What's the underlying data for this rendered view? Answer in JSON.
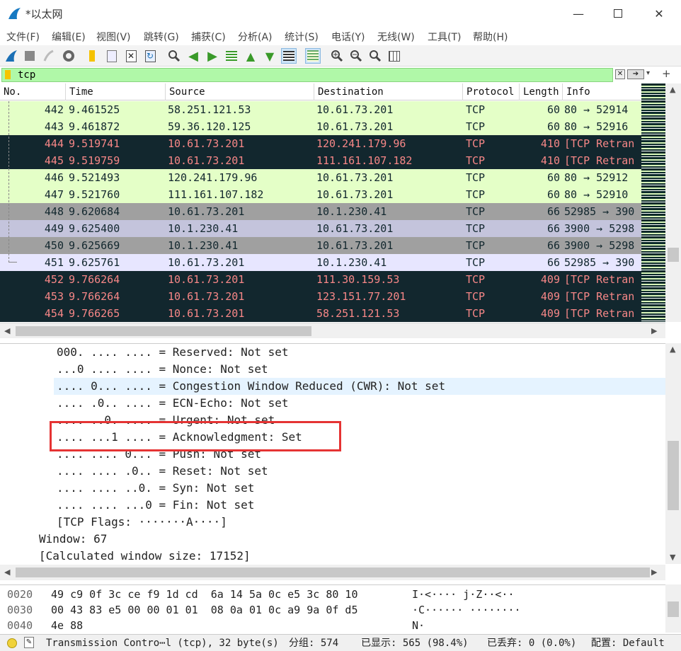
{
  "window": {
    "title": "*以太网"
  },
  "menu": [
    "文件(F)",
    "编辑(E)",
    "视图(V)",
    "跳转(G)",
    "捕获(C)",
    "分析(A)",
    "统计(S)",
    "电话(Y)",
    "无线(W)",
    "工具(T)",
    "帮助(H)"
  ],
  "filter": {
    "value": "tcp"
  },
  "columns": [
    "No.",
    "Time",
    "Source",
    "Destination",
    "Protocol",
    "Length",
    "Info"
  ],
  "packets": [
    {
      "no": "442",
      "time": "9.461525",
      "src": "58.251.121.53",
      "dst": "10.61.73.201",
      "proto": "TCP",
      "len": "60",
      "info": "80 → 52914",
      "bg": "#e4ffc7",
      "fg": "#12272e"
    },
    {
      "no": "443",
      "time": "9.461872",
      "src": "59.36.120.125",
      "dst": "10.61.73.201",
      "proto": "TCP",
      "len": "60",
      "info": "80 → 52916",
      "bg": "#e4ffc7",
      "fg": "#12272e"
    },
    {
      "no": "444",
      "time": "9.519741",
      "src": "10.61.73.201",
      "dst": "120.241.179.96",
      "proto": "TCP",
      "len": "410",
      "info": "[TCP Retran",
      "bg": "#12272e",
      "fg": "#f78787"
    },
    {
      "no": "445",
      "time": "9.519759",
      "src": "10.61.73.201",
      "dst": "111.161.107.182",
      "proto": "TCP",
      "len": "410",
      "info": "[TCP Retran",
      "bg": "#12272e",
      "fg": "#f78787"
    },
    {
      "no": "446",
      "time": "9.521493",
      "src": "120.241.179.96",
      "dst": "10.61.73.201",
      "proto": "TCP",
      "len": "60",
      "info": "80 → 52912",
      "bg": "#e4ffc7",
      "fg": "#12272e"
    },
    {
      "no": "447",
      "time": "9.521760",
      "src": "111.161.107.182",
      "dst": "10.61.73.201",
      "proto": "TCP",
      "len": "60",
      "info": "80 → 52910",
      "bg": "#e4ffc7",
      "fg": "#12272e"
    },
    {
      "no": "448",
      "time": "9.620684",
      "src": "10.61.73.201",
      "dst": "10.1.230.41",
      "proto": "TCP",
      "len": "66",
      "info": "52985 → 390",
      "bg": "#a0a0a0",
      "fg": "#12272e"
    },
    {
      "no": "449",
      "time": "9.625400",
      "src": "10.1.230.41",
      "dst": "10.61.73.201",
      "proto": "TCP",
      "len": "66",
      "info": "3900 → 5298",
      "bg": "#c4c4dc",
      "fg": "#12272e"
    },
    {
      "no": "450",
      "time": "9.625669",
      "src": "10.1.230.41",
      "dst": "10.61.73.201",
      "proto": "TCP",
      "len": "66",
      "info": "3900 → 5298",
      "bg": "#a0a0a0",
      "fg": "#12272e"
    },
    {
      "no": "451",
      "time": "9.625761",
      "src": "10.61.73.201",
      "dst": "10.1.230.41",
      "proto": "TCP",
      "len": "66",
      "info": "52985 → 390",
      "bg": "#e7e6ff",
      "fg": "#12272e"
    },
    {
      "no": "452",
      "time": "9.766264",
      "src": "10.61.73.201",
      "dst": "111.30.159.53",
      "proto": "TCP",
      "len": "409",
      "info": "[TCP Retran",
      "bg": "#12272e",
      "fg": "#f78787"
    },
    {
      "no": "453",
      "time": "9.766264",
      "src": "10.61.73.201",
      "dst": "123.151.77.201",
      "proto": "TCP",
      "len": "409",
      "info": "[TCP Retran",
      "bg": "#12272e",
      "fg": "#f78787"
    },
    {
      "no": "454",
      "time": "9.766265",
      "src": "10.61.73.201",
      "dst": "58.251.121.53",
      "proto": "TCP",
      "len": "409",
      "info": "[TCP Retran",
      "bg": "#12272e",
      "fg": "#f78787"
    }
  ],
  "details": [
    {
      "indent": "80",
      "text": "000. .... .... = Reserved: Not set",
      "selected": false
    },
    {
      "indent": "80",
      "text": "...0 .... .... = Nonce: Not set",
      "selected": false
    },
    {
      "indent": "80",
      "text": ".... 0... .... = Congestion Window Reduced (CWR): Not set",
      "selected": true
    },
    {
      "indent": "80",
      "text": ".... .0.. .... = ECN-Echo: Not set",
      "selected": false
    },
    {
      "indent": "80",
      "text": ".... ..0. .... = Urgent: Not set",
      "selected": false
    },
    {
      "indent": "80",
      "text": ".... ...1 .... = Acknowledgment: Set",
      "selected": false
    },
    {
      "indent": "80",
      "text": ".... .... 0... = Push: Not set",
      "selected": false
    },
    {
      "indent": "80",
      "text": ".... .... .0.. = Reset: Not set",
      "selected": false
    },
    {
      "indent": "80",
      "text": ".... .... ..0. = Syn: Not set",
      "selected": false
    },
    {
      "indent": "80",
      "text": ".... .... ...0 = Fin: Not set",
      "selected": false
    },
    {
      "indent": "80",
      "text": "[TCP Flags: ·······A····]",
      "selected": false
    },
    {
      "indent": "55",
      "text": "Window: 67",
      "selected": false
    },
    {
      "indent": "55",
      "text": "[Calculated window size: 17152]",
      "selected": false
    }
  ],
  "hex": [
    {
      "offset": "0020",
      "bytes": "49 c9 0f 3c ce f9 1d cd  6a 14 5a 0c e5 3c 80 10",
      "ascii": "I·<···· j·Z··<··"
    },
    {
      "offset": "0030",
      "bytes": "00 43 83 e5 00 00 01 01  08 0a 01 0c a9 9a 0f d5",
      "ascii": "·C······ ········"
    },
    {
      "offset": "0040",
      "bytes": "4e 88",
      "ascii": "N·"
    }
  ],
  "status": {
    "field": "Transmission Contro⋯l (tcp), 32 byte(s)",
    "packets": "分组: 574",
    "displayed": "已显示: 565 (98.4%)",
    "dropped": "已丢弃: 0 (0.0%)",
    "profile": "配置: Default"
  }
}
